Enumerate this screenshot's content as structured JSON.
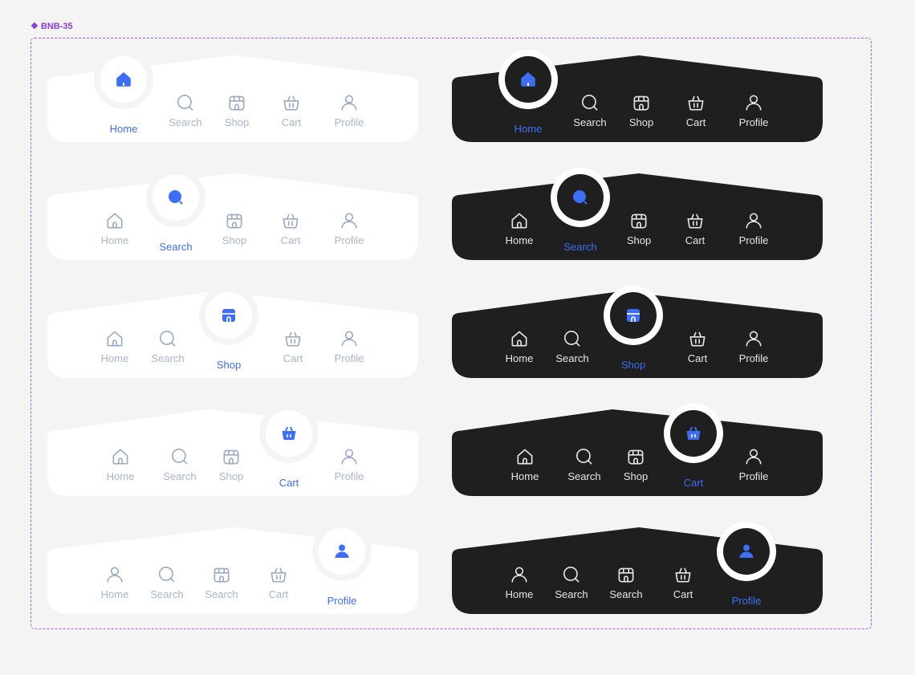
{
  "frame_label": "BNB-35",
  "colors": {
    "accent": "#3d6ef5",
    "dark_bg": "#1f1f1f",
    "light_bg": "#ffffff",
    "light_inactive": "#a9b5c8",
    "dark_inactive": "#e6e6e6"
  },
  "bars": [
    {
      "theme": "light",
      "active": {
        "label": "Home",
        "icon": "home-icon"
      },
      "items": [
        {
          "label": "Search",
          "icon": "search-icon"
        },
        {
          "label": "Shop",
          "icon": "shop-icon"
        },
        {
          "label": "Cart",
          "icon": "cart-icon"
        },
        {
          "label": "Profile",
          "icon": "profile-icon"
        }
      ]
    },
    {
      "theme": "dark",
      "active": {
        "label": "Home",
        "icon": "home-icon"
      },
      "items": [
        {
          "label": "Search",
          "icon": "search-icon"
        },
        {
          "label": "Shop",
          "icon": "shop-icon"
        },
        {
          "label": "Cart",
          "icon": "cart-icon"
        },
        {
          "label": "Profile",
          "icon": "profile-icon"
        }
      ]
    },
    {
      "theme": "light",
      "active": {
        "label": "Search",
        "icon": "search-icon"
      },
      "items": [
        {
          "label": "Home",
          "icon": "home-icon"
        },
        {
          "label": "Shop",
          "icon": "shop-icon"
        },
        {
          "label": "Cart",
          "icon": "cart-icon"
        },
        {
          "label": "Profile",
          "icon": "profile-icon"
        }
      ]
    },
    {
      "theme": "dark",
      "active": {
        "label": "Search",
        "icon": "search-icon"
      },
      "items": [
        {
          "label": "Home",
          "icon": "home-icon"
        },
        {
          "label": "Shop",
          "icon": "shop-icon"
        },
        {
          "label": "Cart",
          "icon": "cart-icon"
        },
        {
          "label": "Profile",
          "icon": "profile-icon"
        }
      ]
    },
    {
      "theme": "light",
      "active": {
        "label": "Shop",
        "icon": "shop-icon"
      },
      "items": [
        {
          "label": "Home",
          "icon": "home-icon"
        },
        {
          "label": "Search",
          "icon": "search-icon"
        },
        {
          "label": "Cart",
          "icon": "cart-icon"
        },
        {
          "label": "Profile",
          "icon": "profile-icon"
        }
      ]
    },
    {
      "theme": "dark",
      "active": {
        "label": "Shop",
        "icon": "shop-icon"
      },
      "items": [
        {
          "label": "Home",
          "icon": "home-icon"
        },
        {
          "label": "Search",
          "icon": "search-icon"
        },
        {
          "label": "Cart",
          "icon": "cart-icon"
        },
        {
          "label": "Profile",
          "icon": "profile-icon"
        }
      ]
    },
    {
      "theme": "light",
      "active": {
        "label": "Cart",
        "icon": "cart-icon"
      },
      "items": [
        {
          "label": "Home",
          "icon": "home-icon"
        },
        {
          "label": "Search",
          "icon": "search-icon"
        },
        {
          "label": "Shop",
          "icon": "shop-icon"
        },
        {
          "label": "Profile",
          "icon": "profile-icon"
        }
      ]
    },
    {
      "theme": "dark",
      "active": {
        "label": "Cart",
        "icon": "cart-icon"
      },
      "items": [
        {
          "label": "Home",
          "icon": "home-icon"
        },
        {
          "label": "Search",
          "icon": "search-icon"
        },
        {
          "label": "Shop",
          "icon": "shop-icon"
        },
        {
          "label": "Profile",
          "icon": "profile-icon"
        }
      ]
    },
    {
      "theme": "light",
      "active": {
        "label": "Profile",
        "icon": "profile-icon"
      },
      "items": [
        {
          "label": "Home",
          "icon": "profile-icon"
        },
        {
          "label": "Search",
          "icon": "search-icon"
        },
        {
          "label": "Search",
          "icon": "shop-icon"
        },
        {
          "label": "Cart",
          "icon": "cart-icon"
        }
      ]
    },
    {
      "theme": "dark",
      "active": {
        "label": "Profile",
        "icon": "profile-icon"
      },
      "items": [
        {
          "label": "Home",
          "icon": "profile-icon"
        },
        {
          "label": "Search",
          "icon": "search-icon"
        },
        {
          "label": "Search",
          "icon": "shop-icon"
        },
        {
          "label": "Cart",
          "icon": "cart-icon"
        }
      ]
    }
  ]
}
